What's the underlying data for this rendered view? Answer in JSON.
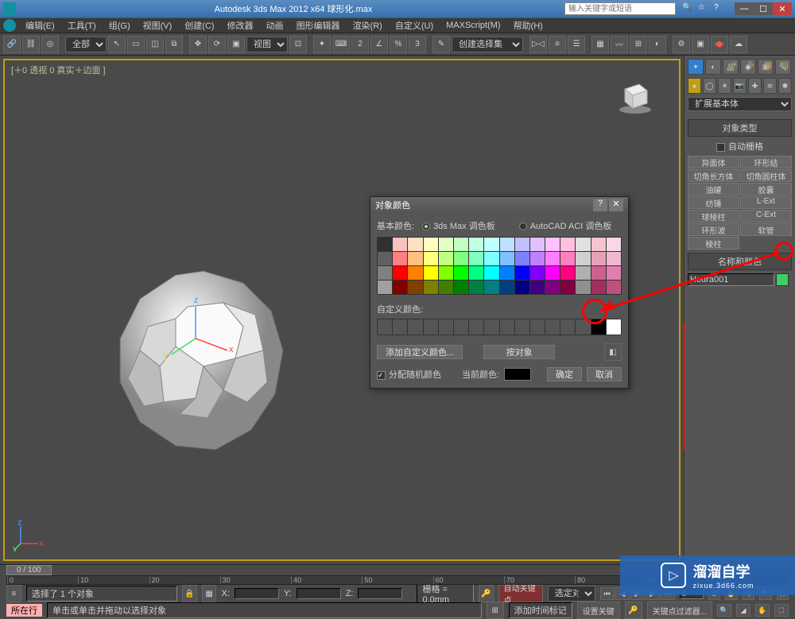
{
  "title": "Autodesk 3ds Max  2012 x64   球形化.max",
  "searchPlaceholder": "输入关键字或短语",
  "menu": [
    "编辑(E)",
    "工具(T)",
    "组(G)",
    "视图(V)",
    "创建(C)",
    "修改器",
    "动画",
    "图形编辑器",
    "渲染(R)",
    "自定义(U)",
    "MAXScript(M)",
    "帮助(H)"
  ],
  "toolbarDropdownAll": "全部",
  "toolbarViewLabel": "视图",
  "toolbarSelectSetLabel": "创建选择集",
  "viewportLabel": "[＋0 透视 0 真实＋边面 ]",
  "dialog": {
    "title": "对象颜色",
    "basicLabel": "基本颜色:",
    "radio3ds": "3ds Max 调色板",
    "radioAcad": "AutoCAD ACI 调色板",
    "customLabel": "自定义颜色:",
    "addCustom": "添加自定义颜色...",
    "byObject": "按对象",
    "assignRandom": "分配随机颜色",
    "currentLabel": "当前颜色:",
    "ok": "确定",
    "cancel": "取消"
  },
  "palette": [
    [
      "#303030",
      "#ffc0c0",
      "#ffe0c0",
      "#ffffc0",
      "#e0ffc0",
      "#c0ffc0",
      "#c0ffe0",
      "#c0ffff",
      "#c0e0ff",
      "#c0c0ff",
      "#e0c0ff",
      "#ffc0ff",
      "#ffc0e0",
      "#e0e0e0",
      "#f4c4d0",
      "#f8d8e8"
    ],
    [
      "#606060",
      "#ff8080",
      "#ffc080",
      "#ffff80",
      "#c0ff80",
      "#80ff80",
      "#80ffc0",
      "#80ffff",
      "#80c0ff",
      "#8080ff",
      "#c080ff",
      "#ff80ff",
      "#ff80c0",
      "#d0d0d0",
      "#e8a0b8",
      "#f0b8d0"
    ],
    [
      "#808080",
      "#ff0000",
      "#ff8000",
      "#ffff00",
      "#80ff00",
      "#00ff00",
      "#00ff80",
      "#00ffff",
      "#0080ff",
      "#0000ff",
      "#8000ff",
      "#ff00ff",
      "#ff0080",
      "#b0b0b0",
      "#d06090",
      "#e080b0"
    ],
    [
      "#a0a0a0",
      "#800000",
      "#804000",
      "#808000",
      "#408000",
      "#008000",
      "#008040",
      "#008080",
      "#004080",
      "#000080",
      "#400080",
      "#800080",
      "#800040",
      "#909090",
      "#a03060",
      "#c05080"
    ]
  ],
  "panel": {
    "category": "扩展基本体",
    "objectTypeHeader": "对象类型",
    "autoGrid": "自动栅格",
    "buttons": [
      [
        "异面体",
        "环形结"
      ],
      [
        "切角长方体",
        "切角圆柱体"
      ],
      [
        "油罐",
        "胶囊"
      ],
      [
        "纺锤",
        "L-Ext"
      ],
      [
        "球棱柱",
        "C-Ext"
      ],
      [
        "环形波",
        "软管"
      ],
      [
        "棱柱",
        ""
      ]
    ],
    "nameColorHeader": "名称和颜色",
    "objectName": "Hedra001"
  },
  "status": {
    "selectedInfo": "选择了 1 个对象",
    "hint": "单击或单击并拖动以选择对象",
    "addTimeTag": "添加时间标记",
    "xLabel": "X:",
    "yLabel": "Y:",
    "zLabel": "Z:",
    "gridLabel": "栅格 = 0.0mm",
    "autoKey": "自动关键点",
    "selFilter": "选定对象",
    "setKey": "设置关键",
    "keyFilterBtn": "关键点过滤器...",
    "frame": "0",
    "timelineLabel": "0 / 100",
    "cmdLabel": "所在行"
  },
  "watermark": {
    "cn": "溜溜自学",
    "en": "zixue.3d66.com"
  }
}
